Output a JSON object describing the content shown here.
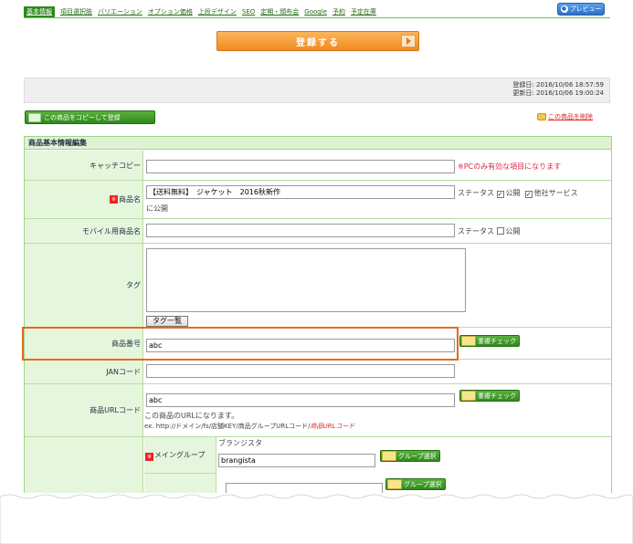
{
  "tabs": [
    {
      "label": "基本情報",
      "active": true
    },
    {
      "label": "項目選択肢"
    },
    {
      "label": "バリエーション"
    },
    {
      "label": "オプション価格"
    },
    {
      "label": "上段デザイン"
    },
    {
      "label": "SEO"
    },
    {
      "label": "定期・頒布会"
    },
    {
      "label": "Google"
    },
    {
      "label": "予約"
    },
    {
      "label": "予定在庫"
    }
  ],
  "preview_label": "プレビュー",
  "register_label": "登録する",
  "dates": {
    "registered": "登録日: 2016/10/06 18:57:59",
    "updated": "更新日: 2016/10/06 19:00:24"
  },
  "copy_label": "この商品をコピーして登録",
  "delete_label": "この商品を削除",
  "panel_title": "商品基本情報編集",
  "fields": {
    "catch_copy": {
      "label": "キャッチコピー",
      "value": "",
      "note": "※PCのみ有効な項目になります"
    },
    "product_name": {
      "label": "商品名",
      "value": "【送料無料】　ジャケット　2016秋新作",
      "status": "ステータス",
      "public": "公開",
      "other_service": "他社サービス",
      "other_service_cont": "に公開"
    },
    "mobile_name": {
      "label": "モバイル用商品名",
      "value": "",
      "status": "ステータス",
      "public": "公開"
    },
    "tag": {
      "label": "タグ",
      "value": "",
      "button": "タグ一覧"
    },
    "product_number": {
      "label": "商品番号",
      "value": "abc",
      "button": "重複チェック"
    },
    "jan": {
      "label": "JANコード",
      "value": ""
    },
    "url_code": {
      "label": "商品URLコード",
      "value": "abc",
      "button": "重複チェック",
      "help1": "この商品のURLになります。",
      "help2": "ex. http://ドメイン/fs/店舗KEY/商品グループURLコード/",
      "help2_red": "商品URLコード"
    },
    "main_group": {
      "label": "メイングループ",
      "store": "ブランジスタ",
      "value": "brangista",
      "button": "グループ選択"
    },
    "sub_group": {
      "button": "グループ選択"
    }
  }
}
